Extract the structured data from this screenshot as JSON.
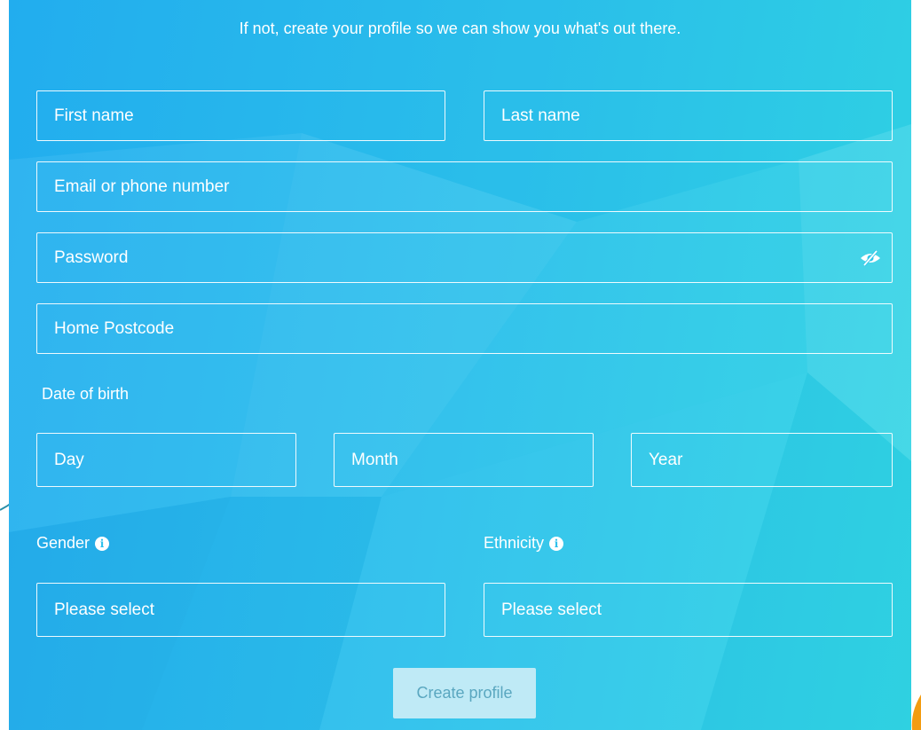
{
  "intro_text": "If not, create your profile so we can show you what's out there.",
  "form": {
    "first_name_placeholder": "First name",
    "last_name_placeholder": "Last name",
    "email_placeholder": "Email or phone number",
    "password_placeholder": "Password",
    "postcode_placeholder": "Home Postcode",
    "dob_label": "Date of birth",
    "day_placeholder": "Day",
    "month_placeholder": "Month",
    "year_placeholder": "Year",
    "gender_label": "Gender",
    "ethnicity_label": "Ethnicity",
    "gender_value": "Please select",
    "ethnicity_value": "Please select",
    "submit_label": "Create profile"
  },
  "icons": {
    "password_toggle": "eye-slash-icon",
    "info": "info-circle-icon",
    "info_glyph": "i"
  },
  "colors": {
    "background_start": "#24aff0",
    "background_end": "#31d6e4",
    "field_border": "#ffffff",
    "button_bg": "#bfeaf6",
    "button_text": "#5aa7c0",
    "accent_orange": "#f39c12"
  }
}
